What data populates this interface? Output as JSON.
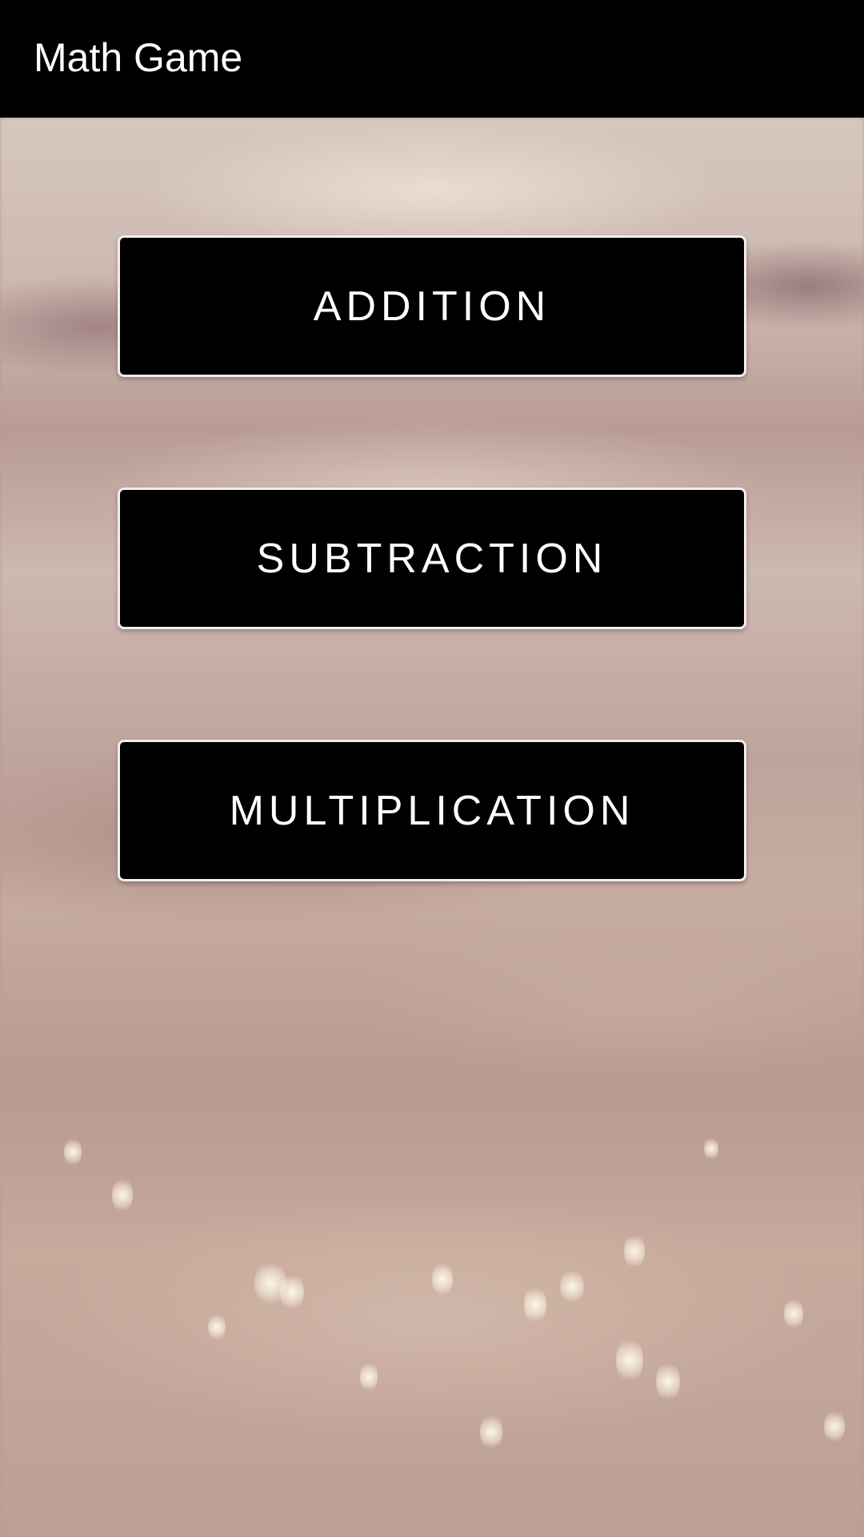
{
  "app_bar": {
    "title": "Math Game"
  },
  "menu": {
    "buttons": [
      {
        "label": "ADDITION"
      },
      {
        "label": "SUBTRACTION"
      },
      {
        "label": "MULTIPLICATION"
      }
    ]
  },
  "colors": {
    "app_bar_background": "#000000",
    "button_background": "#000000",
    "button_border": "#f2eeee",
    "text": "#ffffff"
  }
}
